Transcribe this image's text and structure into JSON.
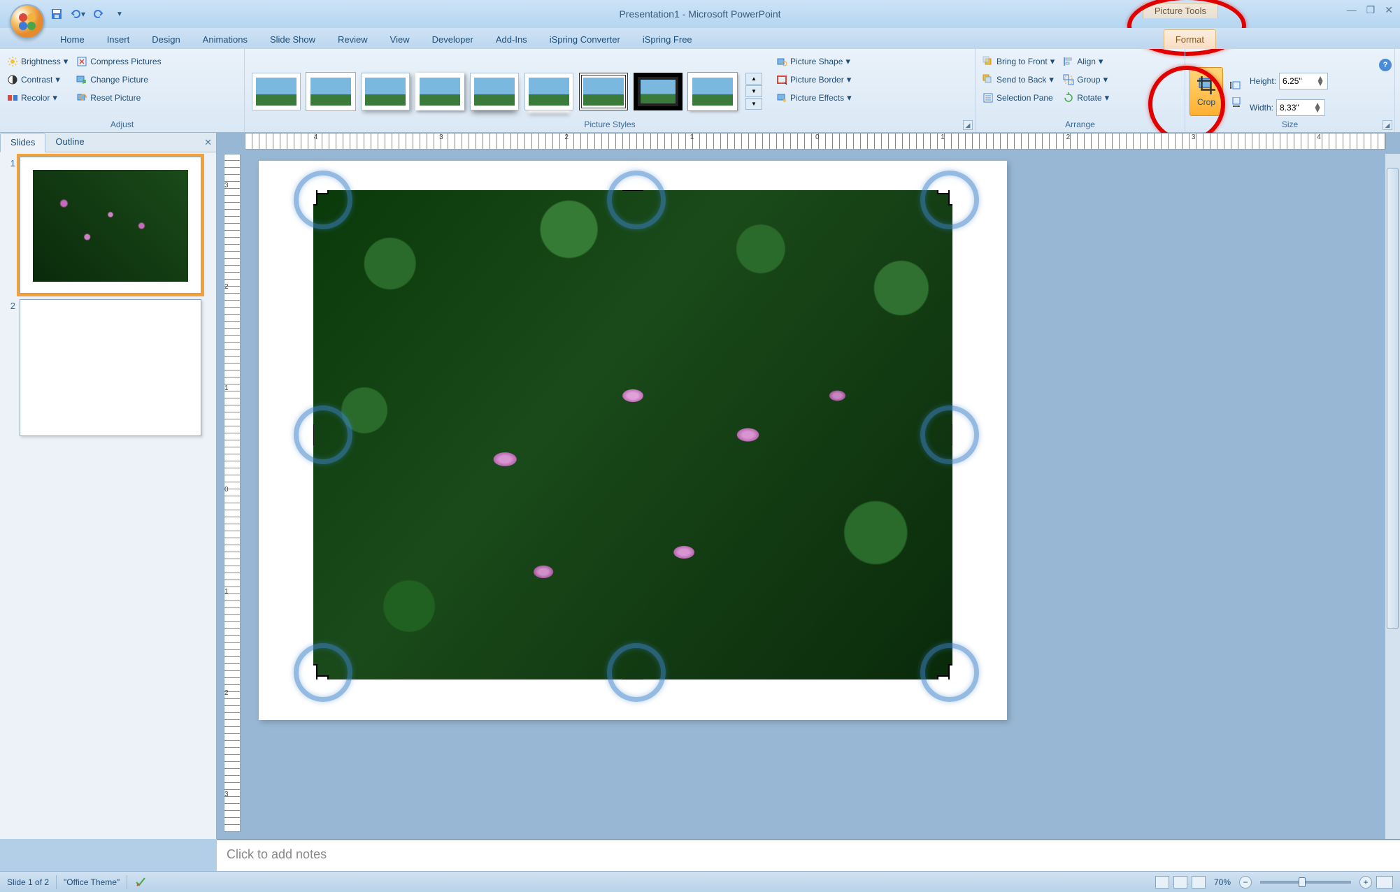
{
  "title": "Presentation1 - Microsoft PowerPoint",
  "picture_tools_label": "Picture Tools",
  "tabs": {
    "home": "Home",
    "insert": "Insert",
    "design": "Design",
    "animations": "Animations",
    "slideshow": "Slide Show",
    "review": "Review",
    "view": "View",
    "developer": "Developer",
    "addins": "Add-Ins",
    "ispring_conv": "iSpring Converter",
    "ispring_free": "iSpring Free",
    "format": "Format"
  },
  "ribbon": {
    "adjust": {
      "label": "Adjust",
      "brightness": "Brightness",
      "contrast": "Contrast",
      "recolor": "Recolor",
      "compress": "Compress Pictures",
      "change": "Change Picture",
      "reset": "Reset Picture"
    },
    "styles": {
      "label": "Picture Styles",
      "shape": "Picture Shape",
      "border": "Picture Border",
      "effects": "Picture Effects"
    },
    "arrange": {
      "label": "Arrange",
      "front": "Bring to Front",
      "back": "Send to Back",
      "selpane": "Selection Pane",
      "align": "Align",
      "group": "Group",
      "rotate": "Rotate"
    },
    "size": {
      "label": "Size",
      "crop": "Crop",
      "height_label": "Height:",
      "width_label": "Width:",
      "height": "6.25\"",
      "width": "8.33\""
    }
  },
  "slidepanel": {
    "tabs": {
      "slides": "Slides",
      "outline": "Outline"
    },
    "slide1": "1",
    "slide2": "2"
  },
  "ruler_h": [
    "4",
    "3",
    "2",
    "1",
    "0",
    "1",
    "2",
    "3",
    "4"
  ],
  "ruler_v": [
    "3",
    "2",
    "1",
    "0",
    "1",
    "2",
    "3"
  ],
  "notes_placeholder": "Click to add notes",
  "status": {
    "slide": "Slide 1 of 2",
    "theme": "\"Office Theme\"",
    "zoom": "70%"
  }
}
